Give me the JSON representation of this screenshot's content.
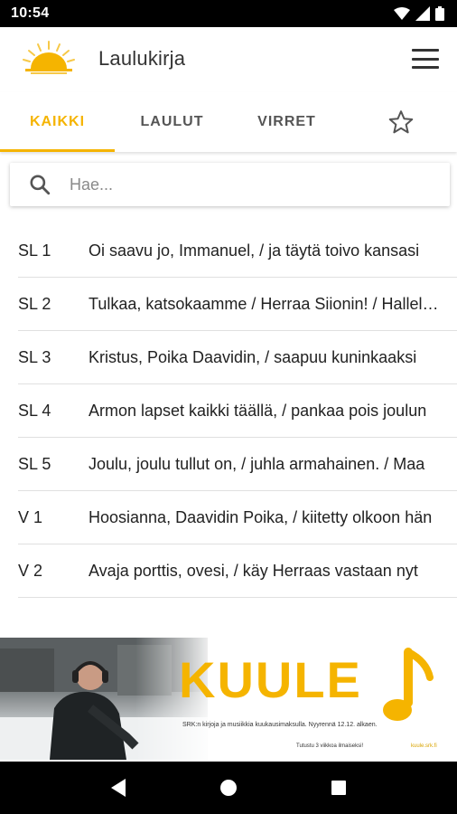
{
  "status_bar": {
    "time": "10:54"
  },
  "app_bar": {
    "title": "Laulukirja"
  },
  "tabs": [
    {
      "label": "KAIKKI",
      "active": true
    },
    {
      "label": "LAULUT",
      "active": false
    },
    {
      "label": "VIRRET",
      "active": false
    }
  ],
  "search": {
    "placeholder": "Hae...",
    "value": ""
  },
  "songs": [
    {
      "number": "SL 1",
      "text": "Oi saavu jo, Immanuel, / ja täytä toivo kansasi"
    },
    {
      "number": "SL 2",
      "text": "Tulkaa, katsokaamme / Herraa Siionin! / Halleluja"
    },
    {
      "number": "SL 3",
      "text": "Kristus, Poika Daavidin, / saapuu kuninkaaksi"
    },
    {
      "number": "SL 4",
      "text": "Armon lapset kaikki täällä, / pankaa pois joulun"
    },
    {
      "number": "SL 5",
      "text": "Joulu, joulu tullut on, / juhla armahainen. / Maa"
    },
    {
      "number": "V 1",
      "text": "Hoosianna, Daavidin Poika, / kiitetty olkoon hän"
    },
    {
      "number": "V 2",
      "text": "Avaja porttis, ovesi, / käy Herraas vastaan nyt"
    }
  ],
  "ad": {
    "brand": "KUULE",
    "caption": "SRK:n kirjoja ja musiikkia kuukausimaksulla. Nyyrennä 12.12. alkaen.",
    "footer_left": "Tutustu 3 viikkoa ilmaiseksi!",
    "footer_right": "kuule.srk.fi",
    "accent": "#f5b400"
  },
  "colors": {
    "accent": "#f5b400",
    "status_bar": "#000000",
    "nav_bar": "#000000"
  },
  "icons": [
    "wifi-icon",
    "signal-icon",
    "battery-icon",
    "hamburger-menu-icon",
    "star-icon",
    "search-icon",
    "back-icon",
    "home-icon",
    "recents-icon"
  ]
}
